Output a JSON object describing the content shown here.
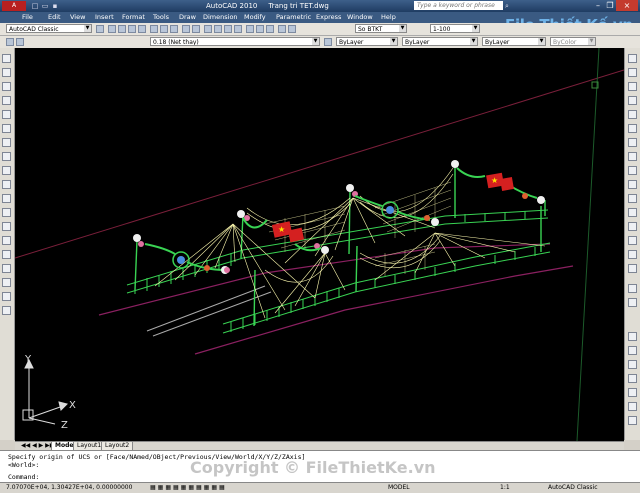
{
  "window": {
    "app_title": "AutoCAD 2010",
    "doc_title": "Trang tri TET.dwg",
    "search_placeholder": "Type a keyword or phrase"
  },
  "menu": [
    "File",
    "Edit",
    "View",
    "Insert",
    "Format",
    "Tools",
    "Draw",
    "Dimension",
    "Modify",
    "Parametric",
    "Express",
    "Window",
    "Help"
  ],
  "toolbar": {
    "workspace": "AutoCAD Classic",
    "layer": "0.18 (Net thay)",
    "color": "ByLayer",
    "linetype": "ByLayer",
    "lineweight": "ByLayer",
    "plotstyle": "ByColor",
    "textstyle": "So BTKT",
    "scale": "1-100"
  },
  "watermark": {
    "brand": "File Thiết Kế.vn",
    "copyright": "Copyright © FileThietKe.vn"
  },
  "ucs": {
    "x": "X",
    "y": "Y",
    "z": "Z"
  },
  "tabs": [
    "Model",
    "Layout1",
    "Layout2"
  ],
  "command": {
    "line1": "Specify origin of UCS or [Face/NAmed/OBject/Previous/View/World/X/Y/Z/ZAxis]",
    "line2": "<World>:",
    "line3": "Command:"
  },
  "status": {
    "coords": "7.07070E+04, 1.30427E+04, 0.00000000",
    "model": "MODEL",
    "scale": "1:1",
    "workspace": "AutoCAD Classic"
  },
  "colors": {
    "canvas": "#000000",
    "railing": "#39d353",
    "string_lights": "#fffbb0",
    "accent_red": "#d42020",
    "title_blue": "#1f3c62"
  }
}
